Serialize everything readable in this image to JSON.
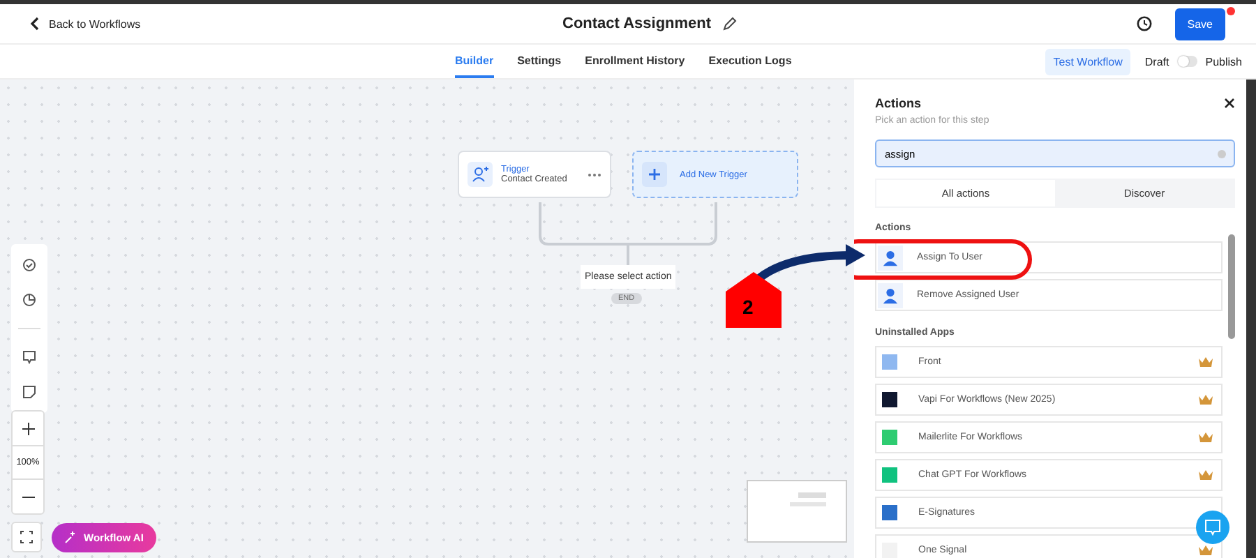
{
  "header": {
    "back": "Back to Workflows",
    "title": "Contact Assignment",
    "save": "Save",
    "unsaved": true
  },
  "tabs": [
    {
      "label": "Builder",
      "selected": true
    },
    {
      "label": "Settings",
      "selected": false
    },
    {
      "label": "Enrollment History",
      "selected": false
    },
    {
      "label": "Execution Logs",
      "selected": false
    }
  ],
  "test_button": "Test Workflow",
  "draft_label": "Draft",
  "publish_label": "Publish",
  "published": false,
  "canvas": {
    "trigger": {
      "title": "Trigger",
      "subtitle": "Contact Created"
    },
    "add_trigger": "Add New Trigger",
    "action_placeholder": "Please select action",
    "end": "END",
    "zoom": "100%",
    "ai_button": "Workflow AI"
  },
  "annotation": {
    "step": "2"
  },
  "panel": {
    "title": "Actions",
    "subtitle": "Pick an action for this step",
    "search": {
      "value": "assign"
    },
    "segments": [
      {
        "label": "All actions",
        "selected": true
      },
      {
        "label": "Discover",
        "selected": false
      }
    ],
    "sections": [
      {
        "heading": "Actions",
        "items": [
          {
            "label": "Assign To User",
            "kind": "action",
            "highlighted": true
          },
          {
            "label": "Remove Assigned User",
            "kind": "action",
            "highlighted": false
          }
        ]
      },
      {
        "heading": "Uninstalled Apps",
        "items": [
          {
            "label": "Front",
            "kind": "app",
            "color": "#8fb8f0",
            "premium": true
          },
          {
            "label": "Vapi For Workflows (New 2025)",
            "kind": "app",
            "color": "#101830",
            "premium": true
          },
          {
            "label": "Mailerlite For Workflows",
            "kind": "app",
            "color": "#2ecc71",
            "premium": true
          },
          {
            "label": "Chat GPT For Workflows",
            "kind": "app",
            "color": "#10c27f",
            "premium": true
          },
          {
            "label": "E-Signatures",
            "kind": "app",
            "color": "#2a6fc9",
            "premium": false
          },
          {
            "label": "One Signal",
            "kind": "app",
            "color": "#f2f2f2",
            "premium": true
          }
        ]
      }
    ]
  }
}
